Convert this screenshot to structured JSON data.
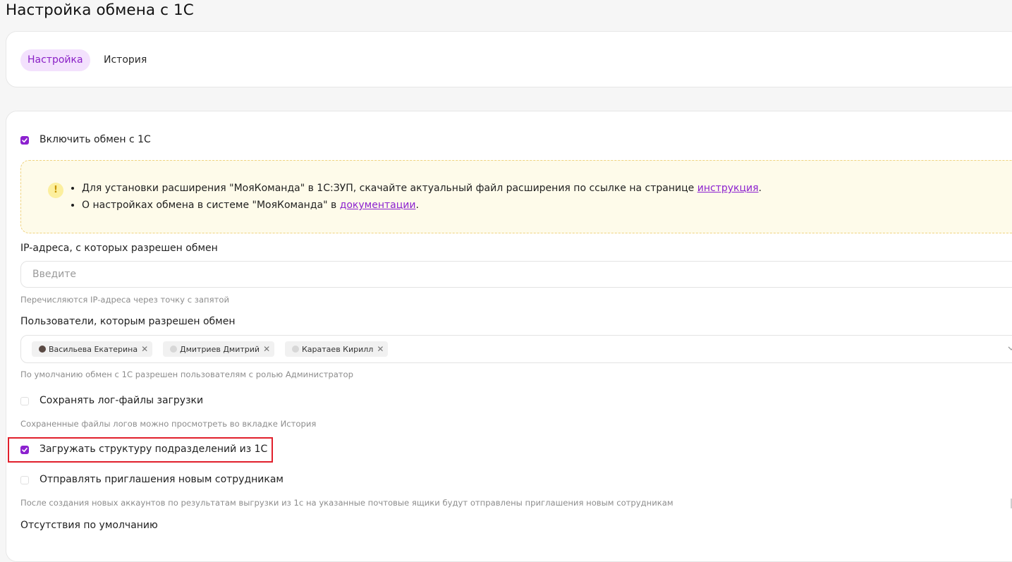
{
  "page": {
    "title": "Настройка обмена с 1С"
  },
  "tabs": [
    {
      "label": "Настройка",
      "active": true
    },
    {
      "label": "История",
      "active": false
    }
  ],
  "enable_exchange": {
    "label": "Включить обмен с 1С",
    "checked": true
  },
  "alert": {
    "icon": "exclamation-icon",
    "line1_text": "Для установки расширения \"МояКоманда\" в 1С:ЗУП, скачайте актуальный файл расширения по ссылке на странице ",
    "line1_link": "инструкция",
    "line1_end": ".",
    "line2_text": "О настройках обмена в системе \"МояКоманда\" в ",
    "line2_link": "документации",
    "line2_end": "."
  },
  "ip_field": {
    "label": "IP-адреса, с которых разрешен обмен",
    "placeholder": "Введите",
    "value": "",
    "hint": "Перечисляются IP-адреса через точку с запятой"
  },
  "users_field": {
    "label": "Пользователи, которым разрешен обмен",
    "chips": [
      {
        "name": "Васильева Екатерина",
        "avatar": "photo"
      },
      {
        "name": "Дмитриев Дмитрий",
        "avatar": "default"
      },
      {
        "name": "Каратаев Кирилл",
        "avatar": "default"
      }
    ],
    "hint": "По умолчанию обмен с 1С разрешен пользователям с ролью Администратор"
  },
  "save_logs": {
    "label": "Сохранять лог-файлы загрузки",
    "checked": false,
    "hint": "Сохраненные файлы логов можно просмотреть во вкладке История"
  },
  "load_structure": {
    "label": "Загружать структуру подразделений из 1С",
    "checked": true,
    "highlighted": true
  },
  "send_invites": {
    "label": "Отправлять приглашения новым сотрудникам",
    "checked": false,
    "hint": "После создания новых аккаунтов по результатам выгрузки из 1с на указанные почтовые ящики будут отправлены приглашения новым сотрудникам"
  },
  "absences": {
    "label": "Отсутствия по умолчанию"
  },
  "colors": {
    "accent": "#8c21cf",
    "tab_active_bg": "#f3e1fd",
    "alert_bg": "#fefbea",
    "highlight": "#e1202c"
  }
}
